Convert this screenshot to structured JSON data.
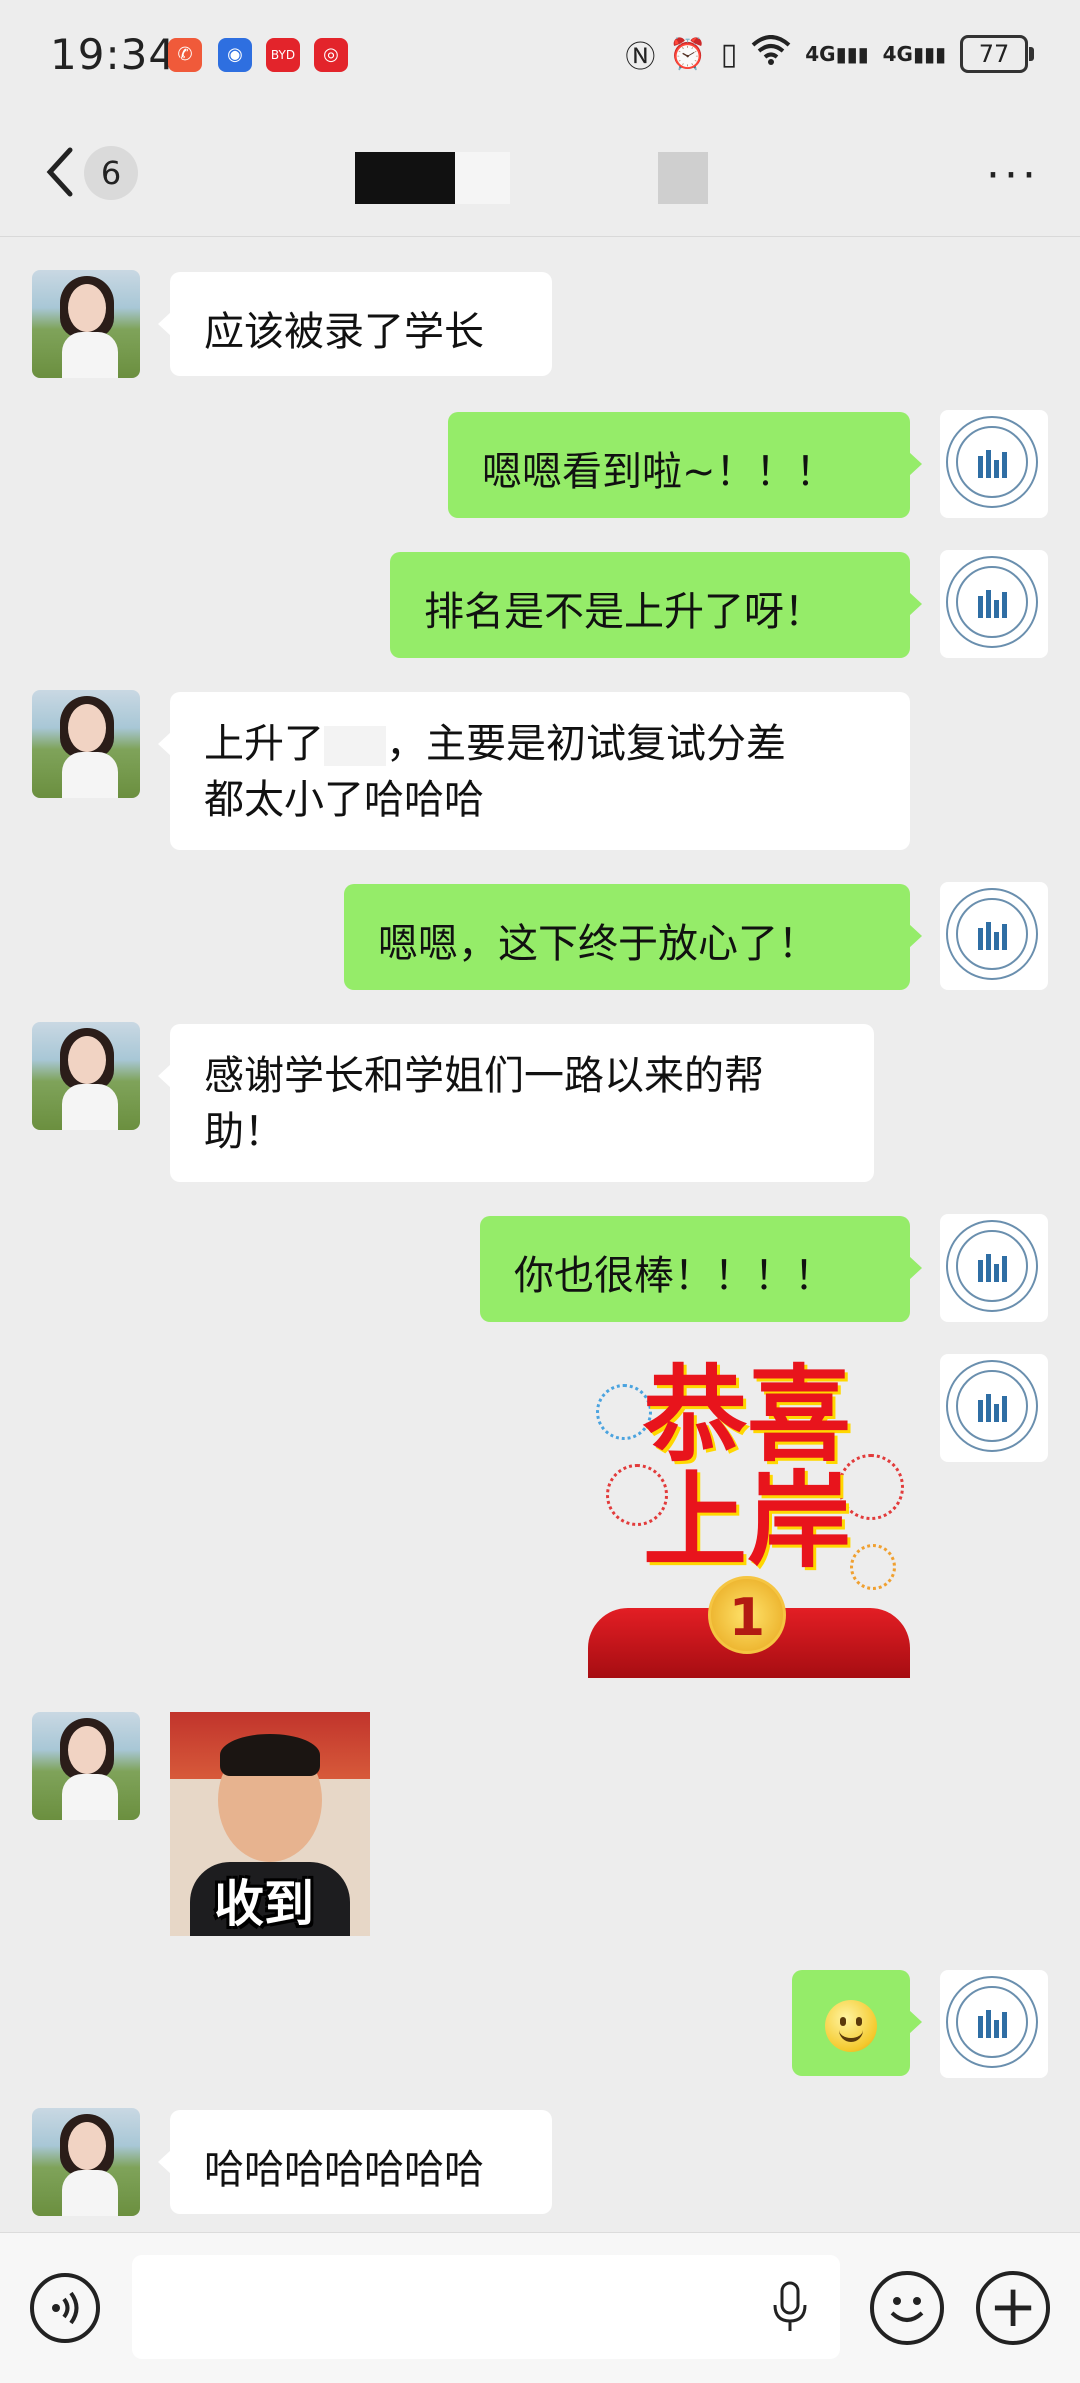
{
  "status_bar": {
    "time": "19:34",
    "battery": "77",
    "net1": "4G",
    "net2": "4G"
  },
  "header": {
    "unread_badge": "6",
    "more_label": "···"
  },
  "messages": [
    {
      "side": "left",
      "text": "应该被录了学长"
    },
    {
      "side": "right",
      "text": "嗯嗯看到啦~！！！"
    },
    {
      "side": "right",
      "text": "排名是不是上升了呀！"
    },
    {
      "side": "left",
      "text_line1": "上升了",
      "text_line1b": "，主要是初试复试分差",
      "text_line2": "都太小了哈哈哈"
    },
    {
      "side": "right",
      "text": "嗯嗯，这下终于放心了！"
    },
    {
      "side": "left",
      "text_line1": "感谢学长和学姐们一路以来的帮",
      "text_line2": "助！"
    },
    {
      "side": "right",
      "text": "你也很棒！！！！"
    },
    {
      "side": "right",
      "type": "sticker",
      "line1": "恭喜",
      "line2": "上岸",
      "medal": "1"
    },
    {
      "side": "left",
      "type": "photo",
      "caption": "收到"
    },
    {
      "side": "right",
      "type": "emoji",
      "emoji": "smile-emoji"
    },
    {
      "side": "left",
      "text": "哈哈哈哈哈哈哈"
    }
  ],
  "input_bar": {
    "voice_icon": "voice-icon",
    "mic_icon": "mic-icon",
    "emoji_icon": "emoji-icon",
    "plus_icon": "plus-icon",
    "plus_label": "+"
  },
  "colors": {
    "background": "#ededed",
    "sent_bubble": "#95ec69",
    "received_bubble": "#ffffff"
  }
}
